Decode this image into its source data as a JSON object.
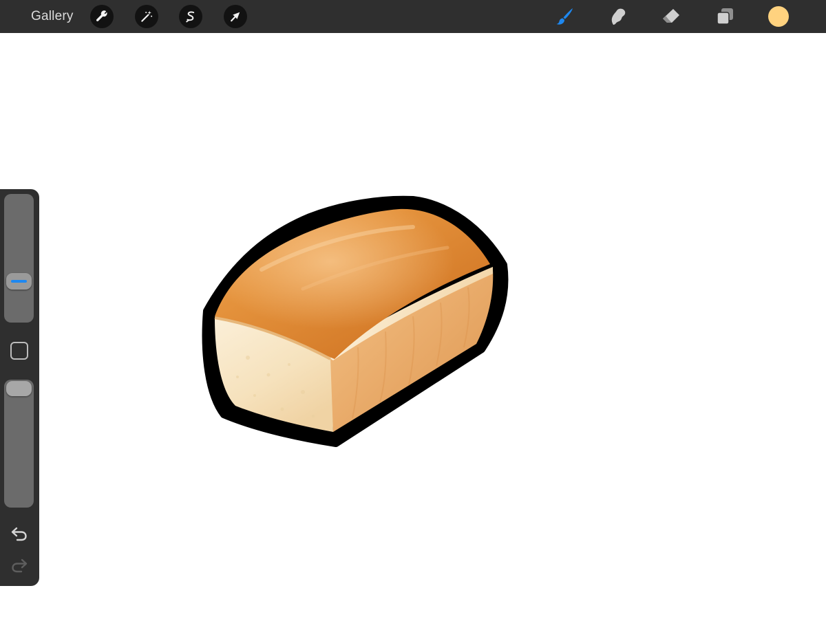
{
  "toolbar": {
    "gallery_label": "Gallery",
    "left_tools": [
      {
        "name": "actions",
        "icon": "wrench-icon"
      },
      {
        "name": "adjustments",
        "icon": "magic-wand-icon"
      },
      {
        "name": "selection",
        "icon": "selection-s-icon"
      },
      {
        "name": "transform",
        "icon": "arrow-cursor-icon"
      }
    ],
    "right_tools": [
      {
        "name": "brush",
        "icon": "paintbrush-icon",
        "active": true
      },
      {
        "name": "smudge",
        "icon": "smudge-finger-icon",
        "active": false
      },
      {
        "name": "eraser",
        "icon": "eraser-icon",
        "active": false
      },
      {
        "name": "layers",
        "icon": "layers-icon",
        "active": false
      }
    ],
    "current_color": "#ffd27f"
  },
  "sidebar": {
    "brush_size_icon": "brush-size-slider",
    "opacity_icon": "opacity-slider",
    "modify_icon": "square-modify-icon",
    "undo_icon": "undo-arrow-icon",
    "redo_icon": "redo-arrow-icon",
    "redo_enabled": false
  },
  "colors": {
    "toolbar_bg": "#2f2f2f",
    "active_tool": "#1e88f0",
    "inactive_tool": "#cfcfcf",
    "canvas_bg": "#ffffff"
  },
  "canvas": {
    "subject": "bread-loaf-sticker"
  }
}
